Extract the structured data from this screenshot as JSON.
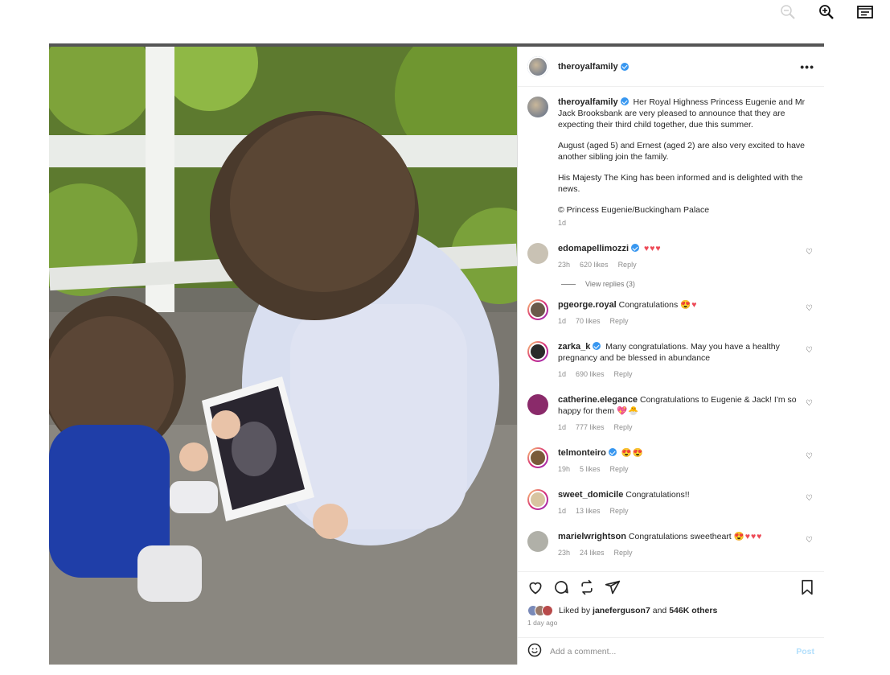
{
  "toolbar": {
    "zoom_out_icon": "zoom-out-icon",
    "zoom_in_icon": "zoom-in-icon",
    "captions_icon": "captions-icon"
  },
  "post": {
    "username": "theroyalfamily",
    "more_label": "•••",
    "caption": {
      "username": "theroyalfamily",
      "paragraphs": [
        "Her Royal Highness Princess Eugenie and Mr Jack Brooksbank are very pleased to announce that they are expecting their third child together, due this summer.",
        "August (aged 5) and Ernest (aged 2) are also very excited to have another sibling join the family.",
        "His Majesty The King has been informed and is delighted with the news.",
        "© Princess Eugenie/Buckingham Palace"
      ],
      "time": "1d"
    },
    "comments": [
      {
        "user": "edomapellimozzi",
        "verified": true,
        "text": "",
        "emoji": "♥♥♥",
        "time": "23h",
        "likes": "620 likes",
        "reply": "Reply",
        "avatar_color": "#c9c2b4"
      },
      {
        "user": "pgeorge.royal",
        "verified": false,
        "text": "Congratulations",
        "emoji": "😍♥",
        "time": "1d",
        "likes": "70 likes",
        "reply": "Reply",
        "avatar_color": "#6a5a4a"
      },
      {
        "user": "zarka_k",
        "verified": true,
        "text": "Many congratulations. May you have a healthy pregnancy and be blessed in abundance",
        "emoji": "",
        "time": "1d",
        "likes": "690 likes",
        "reply": "Reply",
        "avatar_color": "#2a2a2a"
      },
      {
        "user": "catherine.elegance",
        "verified": false,
        "text": "Congratulations to Eugenie & Jack! I'm so happy for them",
        "emoji": "💖🐣",
        "time": "1d",
        "likes": "777 likes",
        "reply": "Reply",
        "avatar_color": "#8a2a6a"
      },
      {
        "user": "telmonteiro",
        "verified": true,
        "text": "",
        "emoji": "😍😍",
        "time": "19h",
        "likes": "5 likes",
        "reply": "Reply",
        "avatar_color": "#7a5a3a"
      },
      {
        "user": "sweet_domicile",
        "verified": false,
        "text": "Congratulations!!",
        "emoji": "",
        "time": "1d",
        "likes": "13 likes",
        "reply": "Reply",
        "avatar_color": "#d8c4a0"
      },
      {
        "user": "marielwrightson",
        "verified": false,
        "text": "Congratulations sweetheart",
        "emoji": "😍♥♥♥",
        "time": "23h",
        "likes": "24 likes",
        "reply": "Reply",
        "avatar_color": "#b0b0a8"
      }
    ],
    "view_replies": "View replies (3)",
    "liked_by_prefix": "Liked by",
    "liked_by_user": "janeferguson7",
    "liked_by_and": "and",
    "liked_by_others": "546K others",
    "time_ago": "1 day ago",
    "comment_placeholder": "Add a comment...",
    "post_label": "Post"
  },
  "colors": {
    "verified": "#3897f0",
    "heart": "#ed4956",
    "post_button": "#b2dffc",
    "meta_text": "#8e8e8e"
  }
}
